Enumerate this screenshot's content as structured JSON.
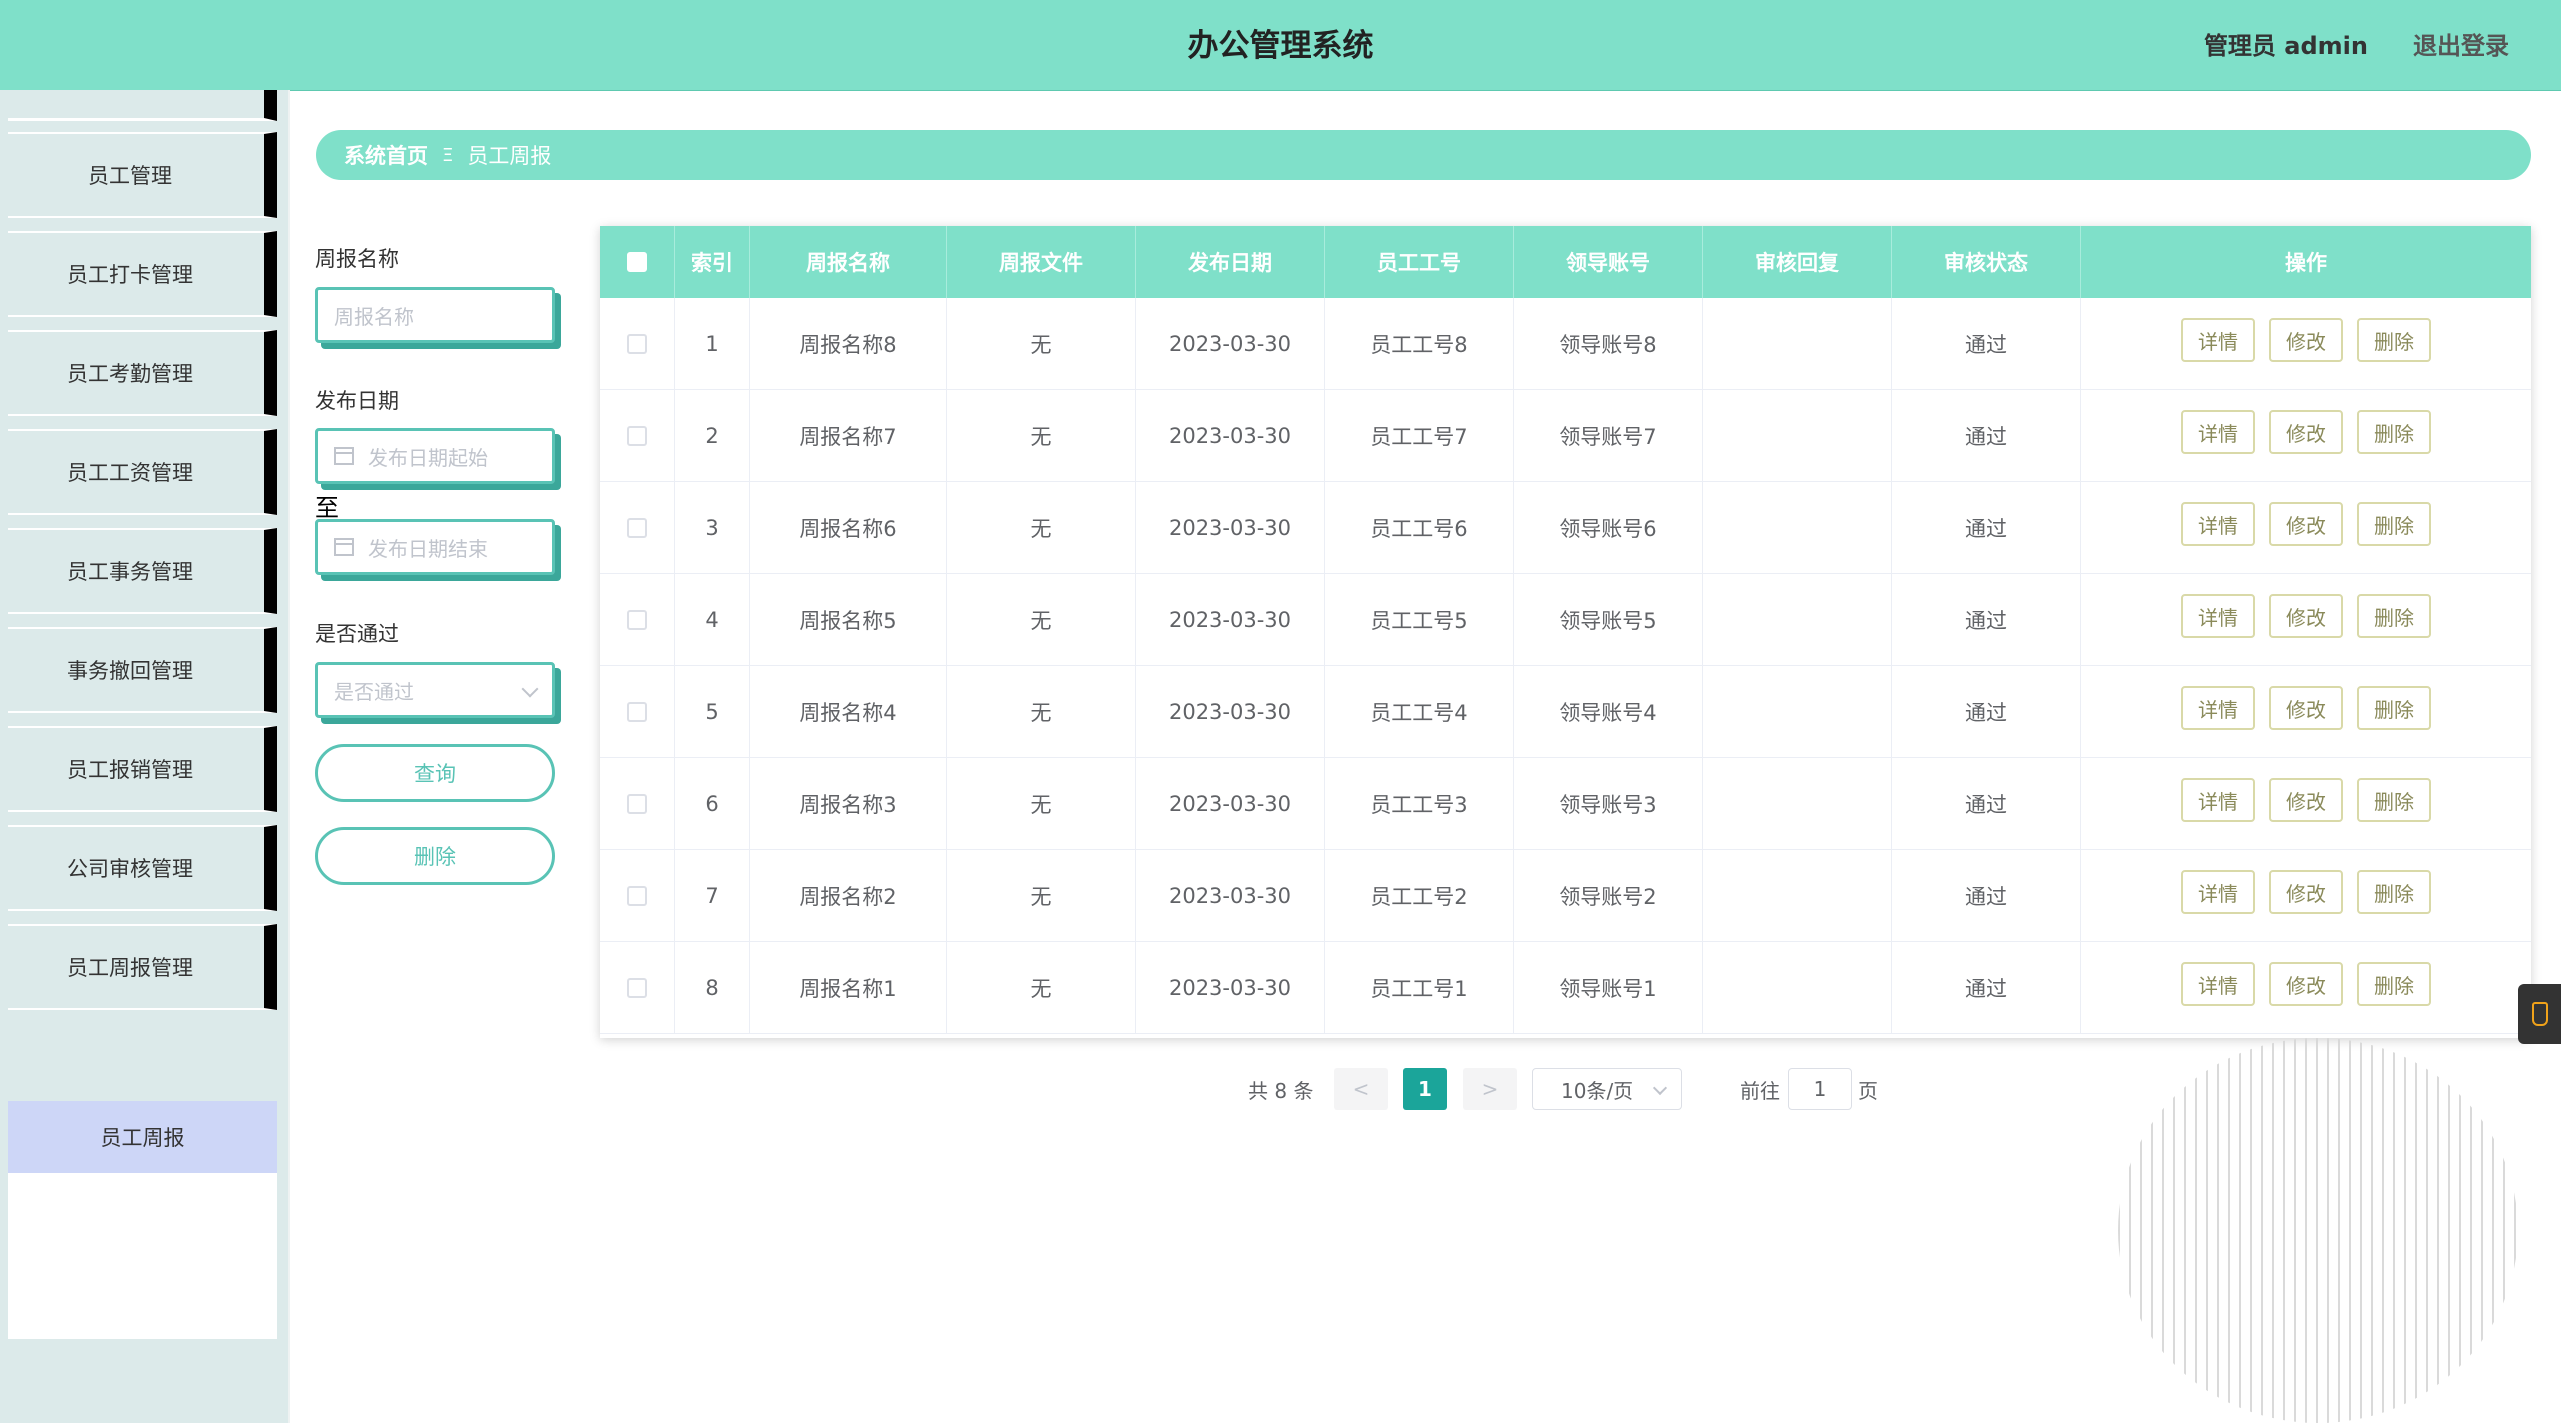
{
  "header": {
    "title": "办公管理系统",
    "user_label": "管理员 admin",
    "logout_label": "退出登录"
  },
  "sidebar": {
    "items": [
      {
        "label": "员工管理"
      },
      {
        "label": "员工打卡管理"
      },
      {
        "label": "员工考勤管理"
      },
      {
        "label": "员工工资管理"
      },
      {
        "label": "员工事务管理"
      },
      {
        "label": "事务撤回管理"
      },
      {
        "label": "员工报销管理"
      },
      {
        "label": "公司审核管理"
      },
      {
        "label": "员工周报管理"
      }
    ],
    "active_sub": "员工周报"
  },
  "breadcrumb": {
    "home": "系统首页",
    "separator": "Ξ",
    "current": "员工周报"
  },
  "filters": {
    "name_label": "周报名称",
    "name_placeholder": "周报名称",
    "date_label": "发布日期",
    "date_start_placeholder": "发布日期起始",
    "date_to": "至",
    "date_end_placeholder": "发布日期结束",
    "pass_label": "是否通过",
    "pass_placeholder": "是否通过",
    "query_button": "查询",
    "delete_button": "删除"
  },
  "table": {
    "columns": [
      "索引",
      "周报名称",
      "周报文件",
      "发布日期",
      "员工工号",
      "领导账号",
      "审核回复",
      "审核状态",
      "操作"
    ],
    "actions": {
      "detail": "详情",
      "edit": "修改",
      "delete": "删除"
    },
    "rows": [
      {
        "index": "1",
        "name": "周报名称8",
        "file": "无",
        "date": "2023-03-30",
        "emp_no": "员工工号8",
        "leader": "领导账号8",
        "reply": "",
        "status": "通过"
      },
      {
        "index": "2",
        "name": "周报名称7",
        "file": "无",
        "date": "2023-03-30",
        "emp_no": "员工工号7",
        "leader": "领导账号7",
        "reply": "",
        "status": "通过"
      },
      {
        "index": "3",
        "name": "周报名称6",
        "file": "无",
        "date": "2023-03-30",
        "emp_no": "员工工号6",
        "leader": "领导账号6",
        "reply": "",
        "status": "通过"
      },
      {
        "index": "4",
        "name": "周报名称5",
        "file": "无",
        "date": "2023-03-30",
        "emp_no": "员工工号5",
        "leader": "领导账号5",
        "reply": "",
        "status": "通过"
      },
      {
        "index": "5",
        "name": "周报名称4",
        "file": "无",
        "date": "2023-03-30",
        "emp_no": "员工工号4",
        "leader": "领导账号4",
        "reply": "",
        "status": "通过"
      },
      {
        "index": "6",
        "name": "周报名称3",
        "file": "无",
        "date": "2023-03-30",
        "emp_no": "员工工号3",
        "leader": "领导账号3",
        "reply": "",
        "status": "通过"
      },
      {
        "index": "7",
        "name": "周报名称2",
        "file": "无",
        "date": "2023-03-30",
        "emp_no": "员工工号2",
        "leader": "领导账号2",
        "reply": "",
        "status": "通过"
      },
      {
        "index": "8",
        "name": "周报名称1",
        "file": "无",
        "date": "2023-03-30",
        "emp_no": "员工工号1",
        "leader": "领导账号1",
        "reply": "",
        "status": "通过"
      }
    ]
  },
  "pagination": {
    "total": "共 8 条",
    "prev": "<",
    "current": "1",
    "next": ">",
    "page_size": "10条/页",
    "goto_label": "前往",
    "goto_value": "1",
    "page_unit": "页"
  },
  "colors": {
    "accent": "#7fe0c9",
    "accent_dark": "#59c3b5",
    "current_page": "#1ba59a",
    "sidebar_bg": "#dceaea",
    "active_sub_bg": "#cdd6f7"
  },
  "icons": {
    "date": "calendar-icon",
    "select": "chevron-down-icon",
    "side_tool": "cup-icon"
  }
}
